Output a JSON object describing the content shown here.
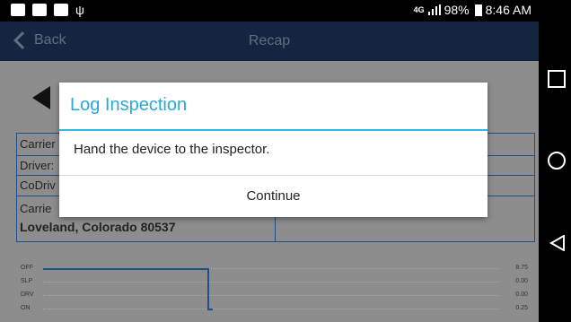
{
  "status_bar": {
    "network": "4G",
    "battery": "98%",
    "time": "8:46 AM"
  },
  "header": {
    "back_label": "Back",
    "title": "Recap"
  },
  "background": {
    "carrier_label": "Carrier",
    "driver_label": "Driver:",
    "codriver_label": "CoDriv",
    "carrier2_label": "Carrie",
    "address": "Loveland, Colorado 80537",
    "graph_rows": [
      {
        "label": "OFF",
        "value": "8.75"
      },
      {
        "label": "SLP",
        "value": "0.00"
      },
      {
        "label": "DRV",
        "value": "0.00"
      },
      {
        "label": "ON",
        "value": "0.25"
      }
    ]
  },
  "dialog": {
    "title": "Log Inspection",
    "message": "Hand the device to the inspector.",
    "button": "Continue"
  },
  "colors": {
    "accent": "#33b5e5",
    "appbar": "#13253f",
    "line": "#1f4f86"
  }
}
